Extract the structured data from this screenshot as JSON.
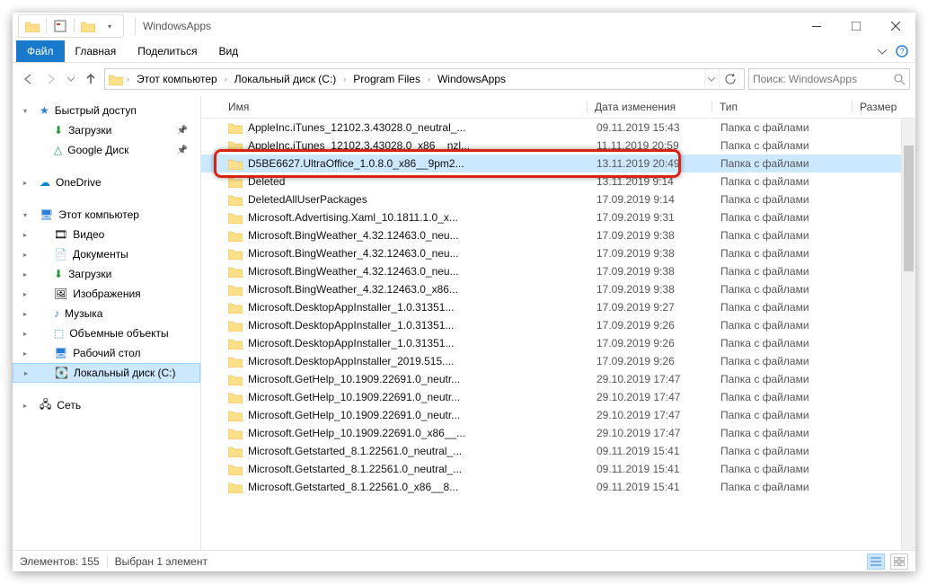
{
  "titlebar": {
    "title": "WindowsApps"
  },
  "ribbon": {
    "file": "Файл",
    "home": "Главная",
    "share": "Поделиться",
    "view": "Вид"
  },
  "breadcrumb": {
    "root": "Этот компьютер",
    "drive": "Локальный диск (C:)",
    "pf": "Program Files",
    "current": "WindowsApps"
  },
  "search": {
    "placeholder": "Поиск: WindowsApps"
  },
  "columns": {
    "name": "Имя",
    "date": "Дата изменения",
    "type": "Тип",
    "size": "Размер"
  },
  "sidebar": {
    "quick": "Быстрый доступ",
    "downloads": "Загрузки",
    "gdrive": "Google Диск",
    "onedrive": "OneDrive",
    "thispc": "Этот компьютер",
    "video": "Видео",
    "documents": "Документы",
    "downloads2": "Загрузки",
    "pictures": "Изображения",
    "music": "Музыка",
    "objects3d": "Объемные объекты",
    "desktop": "Рабочий стол",
    "cdrive": "Локальный диск (C:)",
    "network": "Сеть"
  },
  "type_folder": "Папка с файлами",
  "files": [
    {
      "name": "AppleInc.iTunes_12102.3.43028.0_neutral_...",
      "date": "09.11.2019 15:43"
    },
    {
      "name": "AppleInc.iTunes_12102.3.43028.0_x86__nzl...",
      "date": "11.11.2019 20:59"
    },
    {
      "name": "D5BE6627.UltraOffice_1.0.8.0_x86__9pm2...",
      "date": "13.11.2019 20:49",
      "selected": true
    },
    {
      "name": "Deleted",
      "date": "13.11.2019 9:14"
    },
    {
      "name": "DeletedAllUserPackages",
      "date": "17.09.2019 9:14"
    },
    {
      "name": "Microsoft.Advertising.Xaml_10.1811.1.0_x...",
      "date": "17.09.2019 9:31"
    },
    {
      "name": "Microsoft.BingWeather_4.32.12463.0_neu...",
      "date": "17.09.2019 9:38"
    },
    {
      "name": "Microsoft.BingWeather_4.32.12463.0_neu...",
      "date": "17.09.2019 9:38"
    },
    {
      "name": "Microsoft.BingWeather_4.32.12463.0_neu...",
      "date": "17.09.2019 9:38"
    },
    {
      "name": "Microsoft.BingWeather_4.32.12463.0_x86...",
      "date": "17.09.2019 9:38"
    },
    {
      "name": "Microsoft.DesktopAppInstaller_1.0.31351...",
      "date": "17.09.2019 9:27"
    },
    {
      "name": "Microsoft.DesktopAppInstaller_1.0.31351...",
      "date": "17.09.2019 9:26"
    },
    {
      "name": "Microsoft.DesktopAppInstaller_1.0.31351...",
      "date": "17.09.2019 9:26"
    },
    {
      "name": "Microsoft.DesktopAppInstaller_2019.515....",
      "date": "17.09.2019 9:26"
    },
    {
      "name": "Microsoft.GetHelp_10.1909.22691.0_neutr...",
      "date": "29.10.2019 17:47"
    },
    {
      "name": "Microsoft.GetHelp_10.1909.22691.0_neutr...",
      "date": "29.10.2019 17:47"
    },
    {
      "name": "Microsoft.GetHelp_10.1909.22691.0_neutr...",
      "date": "29.10.2019 17:47"
    },
    {
      "name": "Microsoft.GetHelp_10.1909.22691.0_x86__...",
      "date": "29.10.2019 17:47"
    },
    {
      "name": "Microsoft.Getstarted_8.1.22561.0_neutral_...",
      "date": "09.11.2019 15:41"
    },
    {
      "name": "Microsoft.Getstarted_8.1.22561.0_neutral_...",
      "date": "09.11.2019 15:41"
    },
    {
      "name": "Microsoft.Getstarted_8.1.22561.0_x86__8...",
      "date": "09.11.2019 15:41"
    }
  ],
  "status": {
    "count_label": "Элементов:",
    "count": "155",
    "selection": "Выбран 1 элемент"
  }
}
